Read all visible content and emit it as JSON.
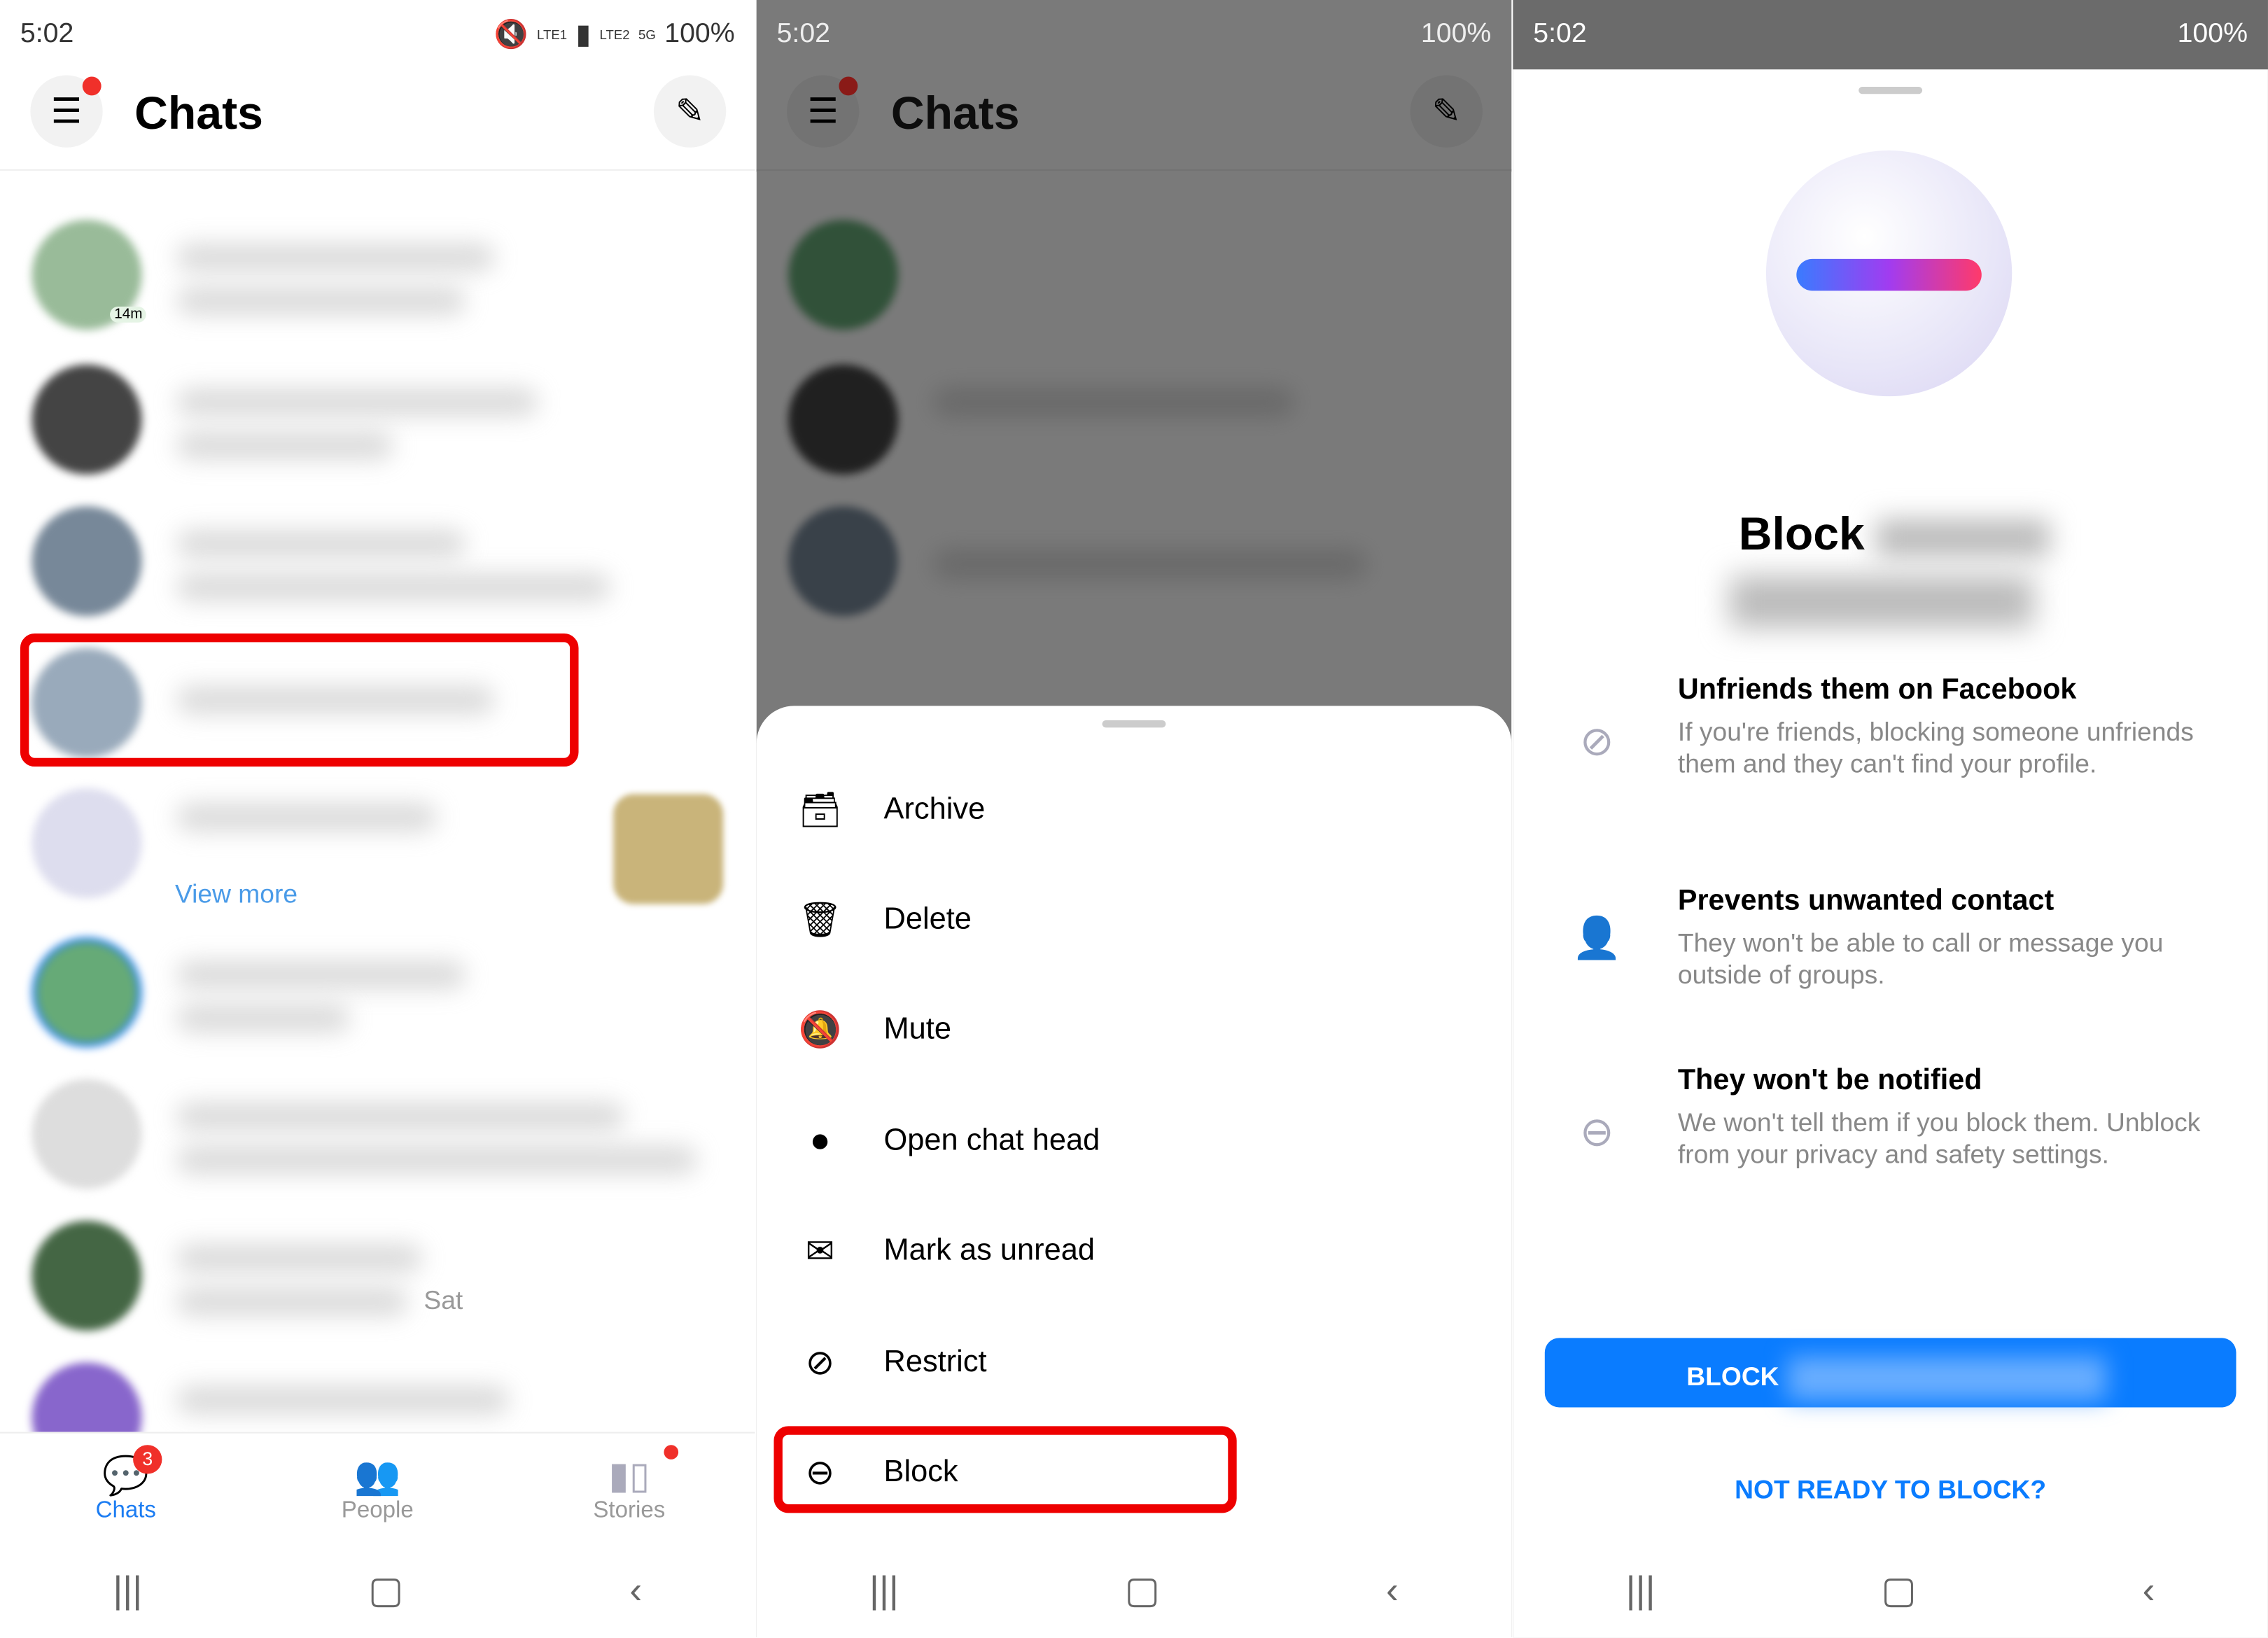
{
  "status_bar": {
    "time": "5:02",
    "battery": "100%",
    "sim1": "LTE1",
    "sim2": "LTE2",
    "network": "5G"
  },
  "panel1": {
    "title": "Chats",
    "rows": [
      {
        "badge": "14m"
      },
      {},
      {},
      {},
      {
        "link": "View more"
      },
      {},
      {},
      {
        "time": "Sat"
      },
      {}
    ],
    "tabs": [
      {
        "label": "Chats",
        "badge": "3",
        "active": true
      },
      {
        "label": "People"
      },
      {
        "label": "Stories",
        "dot": true
      }
    ]
  },
  "panel2": {
    "title": "Chats",
    "menu": [
      {
        "label": "Archive",
        "icon": "archive-icon"
      },
      {
        "label": "Delete",
        "icon": "trash-icon"
      },
      {
        "label": "Mute",
        "icon": "bell-off-icon"
      },
      {
        "label": "Open chat head",
        "icon": "chat-head-icon"
      },
      {
        "label": "Mark as unread",
        "icon": "envelope-icon"
      },
      {
        "label": "Restrict",
        "icon": "restrict-icon"
      },
      {
        "label": "Block",
        "icon": "block-icon",
        "highlighted": true
      }
    ]
  },
  "panel3": {
    "title": "Block",
    "sections": [
      {
        "heading": "Unfriends them on Facebook",
        "body": "If you're friends, blocking someone unfriends them and they can't find your profile.",
        "icon": "eye-slash-icon"
      },
      {
        "heading": "Prevents unwanted contact",
        "body": "They won't be able to call or message you outside of groups.",
        "icon": "user-x-icon"
      },
      {
        "heading": "They won't be notified",
        "body": "We won't tell them if you block them. Unblock from your privacy and safety settings.",
        "icon": "minus-circle-icon"
      }
    ],
    "block_button": "BLOCK",
    "cancel_link": "NOT READY TO BLOCK?"
  },
  "colors": {
    "accent": "#0A7CFF",
    "highlight": "#E00000",
    "badge": "#F0302A"
  }
}
